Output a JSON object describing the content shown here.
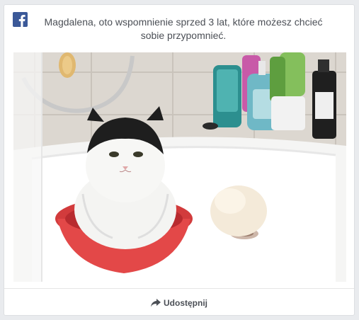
{
  "app": {
    "logo_icon": "facebook-logo-icon",
    "brand_color": "#3b5998"
  },
  "memory": {
    "headline": "Magdalena, oto wspomnienie sprzed 3 lat, które możesz chcieć sobie przypomnieć."
  },
  "photo": {
    "subject": "photo"
  },
  "actions": {
    "share_label": "Udostępnij",
    "share_icon": "share-arrow-icon"
  }
}
